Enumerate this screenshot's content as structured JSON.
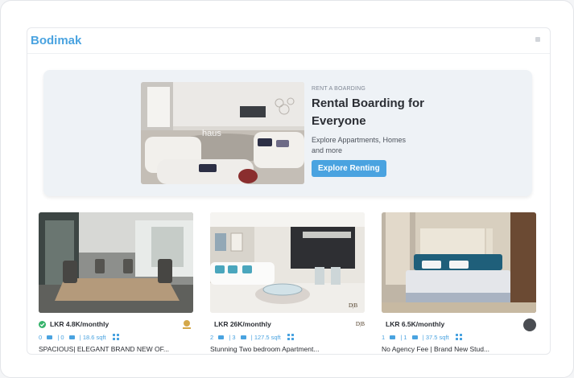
{
  "header": {
    "brand": "Bodimak"
  },
  "hero": {
    "eyebrow": "RENT A BOARDING",
    "title": "Rental Boarding for Everyone",
    "description": "Explore Appartments, Homes and more",
    "cta_label": "Explore Renting",
    "image_watermark": "haus"
  },
  "listings": [
    {
      "price": "LKR 4.8K/monthly",
      "beds": "0",
      "baths": "0",
      "area": "18.6 sqft",
      "title": "SPACIOUS| ELEGANT BRAND NEW OF...",
      "verified": true,
      "agent_logo": "gold-crest-logo"
    },
    {
      "price": "LKR 26K/monthly",
      "beds": "2",
      "baths": "3",
      "area": "127.5 sqft",
      "title": "Stunning Two bedroom Apartment...",
      "verified": false,
      "agent_logo_text": "D|B",
      "agent_logo": "db-text-logo"
    },
    {
      "price": "LKR 6.5K/monthly",
      "beds": "1",
      "baths": "1",
      "area": "37.5 sqft",
      "title": "No Agency Fee | Brand New Stud...",
      "verified": false,
      "agent_logo": "dark-round-logo"
    }
  ],
  "colors": {
    "accent": "#4aa3e0",
    "verified": "#36b36b",
    "hero_bg": "#eef2f6"
  }
}
